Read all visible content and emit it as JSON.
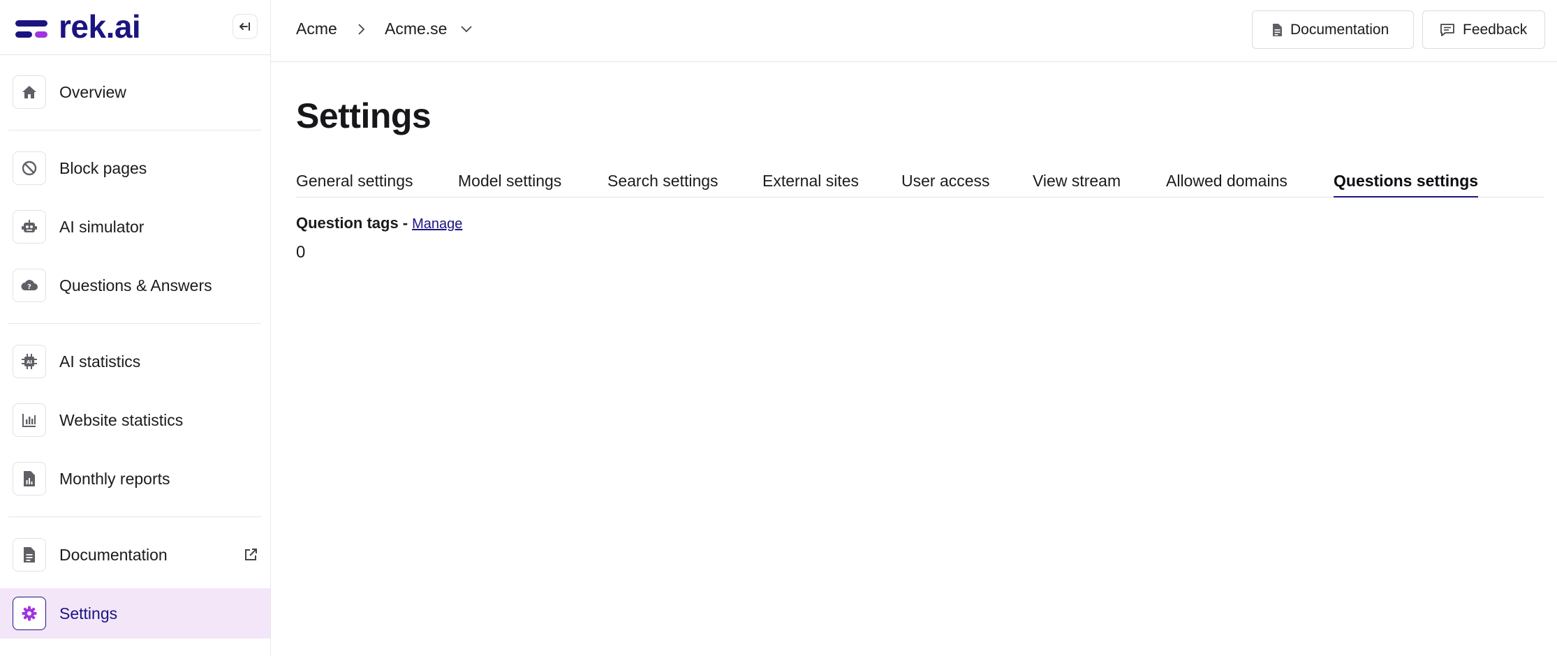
{
  "brand": {
    "name": "rek.ai",
    "colors": {
      "primary": "#1b1480",
      "accent": "#a235e0",
      "active_bg": "#f3e6f8"
    }
  },
  "sidebar": {
    "collapse_icon": "collapse-left-icon",
    "items": [
      {
        "label": "Overview",
        "icon": "home-icon"
      },
      {
        "label": "Block pages",
        "icon": "block-icon"
      },
      {
        "label": "AI simulator",
        "icon": "robot-icon"
      },
      {
        "label": "Questions & Answers",
        "icon": "cloud-question-icon"
      },
      {
        "label": "AI statistics",
        "icon": "chip-icon"
      },
      {
        "label": "Website statistics",
        "icon": "bar-chart-icon"
      },
      {
        "label": "Monthly reports",
        "icon": "report-icon"
      },
      {
        "label": "Documentation",
        "icon": "document-icon",
        "external": true
      },
      {
        "label": "Settings",
        "icon": "gear-icon",
        "active": true
      }
    ]
  },
  "topbar": {
    "breadcrumb": [
      "Acme",
      "Acme.se"
    ],
    "documentation_label": "Documentation",
    "feedback_label": "Feedback"
  },
  "main": {
    "title": "Settings",
    "tabs": [
      {
        "label": "General settings"
      },
      {
        "label": "Model settings"
      },
      {
        "label": "Search settings"
      },
      {
        "label": "External sites"
      },
      {
        "label": "User access"
      },
      {
        "label": "View stream"
      },
      {
        "label": "Allowed domains"
      },
      {
        "label": "Questions settings",
        "active": true
      }
    ],
    "section": {
      "label": "Question tags -",
      "link": "Manage",
      "value": "0"
    }
  }
}
